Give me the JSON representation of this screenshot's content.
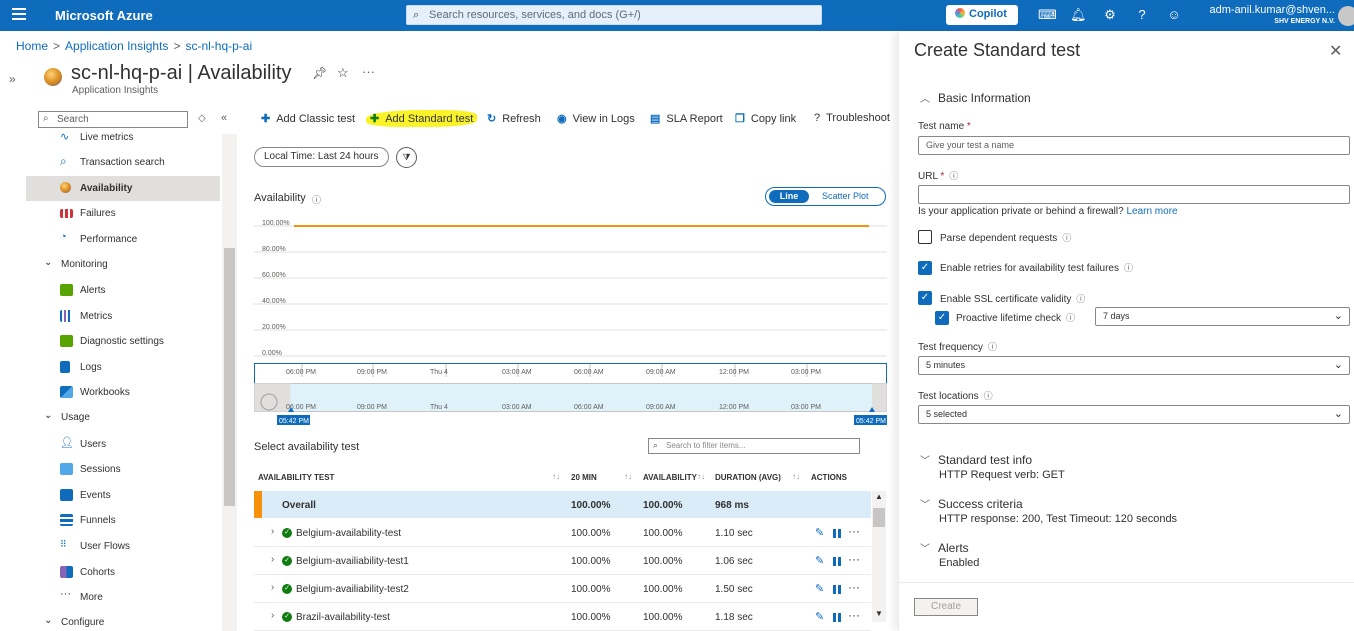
{
  "topbar": {
    "brand": "Microsoft Azure",
    "search_placeholder": "Search resources, services, and docs (G+/)",
    "copilot_label": "Copilot",
    "account_user": "adm-anil.kumar@shven...",
    "account_tenant": "SHV ENERGY N.V."
  },
  "breadcrumb": [
    "Home",
    "Application Insights",
    "sc-nl-hq-p-ai"
  ],
  "header": {
    "title": "sc-nl-hq-p-ai | Availability",
    "subtitle": "Application Insights"
  },
  "nav": {
    "search_placeholder": "Search",
    "items": [
      {
        "label": "Live metrics",
        "icon": "live-metrics-icon",
        "color": "#0f6cbd"
      },
      {
        "label": "Transaction search",
        "icon": "search-icon",
        "color": "#0f6cbd"
      },
      {
        "label": "Availability",
        "icon": "globe-icon",
        "color": "#e8a33b",
        "active": true
      },
      {
        "label": "Failures",
        "icon": "failures-icon",
        "color": "#d13438"
      },
      {
        "label": "Performance",
        "icon": "performance-icon",
        "color": "#0f6cbd"
      }
    ],
    "group_monitoring": "Monitoring",
    "monitoring_items": [
      {
        "label": "Alerts",
        "icon": "alerts-icon",
        "color": "#57a300"
      },
      {
        "label": "Metrics",
        "icon": "metrics-icon",
        "color": "#0f6cbd"
      },
      {
        "label": "Diagnostic settings",
        "icon": "diagnostic-settings-icon",
        "color": "#57a300"
      },
      {
        "label": "Logs",
        "icon": "logs-icon",
        "color": "#0f6cbd"
      },
      {
        "label": "Workbooks",
        "icon": "workbooks-icon",
        "color": "#0f6cbd"
      }
    ],
    "group_usage": "Usage",
    "usage_items": [
      {
        "label": "Users",
        "icon": "users-icon",
        "color": "#0f6cbd"
      },
      {
        "label": "Sessions",
        "icon": "sessions-icon",
        "color": "#0f6cbd"
      },
      {
        "label": "Events",
        "icon": "events-icon",
        "color": "#0f6cbd"
      },
      {
        "label": "Funnels",
        "icon": "funnels-icon",
        "color": "#0f6cbd"
      },
      {
        "label": "User Flows",
        "icon": "user-flows-icon",
        "color": "#0f6cbd"
      },
      {
        "label": "Cohorts",
        "icon": "cohorts-icon",
        "color": "#8764b8"
      },
      {
        "label": "More",
        "icon": "more-icon",
        "color": "#323130"
      }
    ],
    "group_configure": "Configure"
  },
  "toolbar": {
    "add_classic": "Add Classic test",
    "add_standard": "Add Standard test",
    "refresh": "Refresh",
    "view_logs": "View in Logs",
    "sla_report": "SLA Report",
    "copy_link": "Copy link",
    "troubleshoot": "Troubleshoot"
  },
  "time_filter": "Local Time: Last 24 hours",
  "chart_toggle": {
    "line": "Line",
    "scatter": "Scatter Plot"
  },
  "chart_data": {
    "type": "line",
    "title": "Availability",
    "y_ticks": [
      "100.00%",
      "80.00%",
      "60.00%",
      "40.00%",
      "20.00%",
      "0.00%"
    ],
    "ylim": [
      0,
      100
    ],
    "x_ticks": [
      "06:00 PM",
      "09:00 PM",
      "Thu 4",
      "03:00 AM",
      "06:00 AM",
      "09:00 AM",
      "12:00 PM",
      "03:00 PM"
    ],
    "brush_ticks": [
      "06:00 PM",
      "09:00 PM",
      "Thu 4",
      "03:00 AM",
      "06:00 AM",
      "09:00 AM",
      "12:00 PM",
      "03:00 PM"
    ],
    "brush_start": "05:42 PM",
    "brush_end": "05:42 PM",
    "series": [
      {
        "values": [
          100,
          100,
          100,
          100,
          100,
          100,
          100,
          100,
          100
        ],
        "color": "#f7900a"
      }
    ],
    "grid": true
  },
  "grid": {
    "title": "Select availability test",
    "filter_placeholder": "Search to filter items...",
    "columns": [
      "AVAILABILITY TEST",
      "20 MIN",
      "AVAILABILITY",
      "DURATION (AVG)",
      "ACTIONS"
    ],
    "overall": {
      "name": "Overall",
      "min20": "100.00%",
      "availability": "100.00%",
      "duration": "968 ms"
    },
    "rows": [
      {
        "name": "Belgium-availability-test",
        "min20": "100.00%",
        "availability": "100.00%",
        "duration": "1.10 sec"
      },
      {
        "name": "Belgium-availiability-test1",
        "min20": "100.00%",
        "availability": "100.00%",
        "duration": "1.06 sec"
      },
      {
        "name": "Belgium-availiability-test2",
        "min20": "100.00%",
        "availability": "100.00%",
        "duration": "1.50 sec"
      },
      {
        "name": "Brazil-availability-test",
        "min20": "100.00%",
        "availability": "100.00%",
        "duration": "1.18 sec"
      }
    ]
  },
  "panel": {
    "title": "Create Standard test",
    "basic_info": "Basic Information",
    "test_name_label": "Test name",
    "test_name_placeholder": "Give your test a name",
    "url_label": "URL",
    "firewall_text": "Is your application private or behind a firewall?",
    "firewall_link": "Learn more",
    "parse_dependent": "Parse dependent requests",
    "enable_retries": "Enable retries for availability test failures",
    "enable_ssl": "Enable SSL certificate validity",
    "proactive_check": "Proactive lifetime check",
    "proactive_value": "7 days",
    "frequency_label": "Test frequency",
    "frequency_value": "5 minutes",
    "locations_label": "Test locations",
    "locations_value": "5 selected",
    "std_info_hdr": "Standard test info",
    "std_info_val": "HTTP Request verb: GET",
    "success_hdr": "Success criteria",
    "success_val": "HTTP response: 200, Test Timeout: 120 seconds",
    "alerts_hdr": "Alerts",
    "alerts_val": "Enabled",
    "create_label": "Create"
  }
}
